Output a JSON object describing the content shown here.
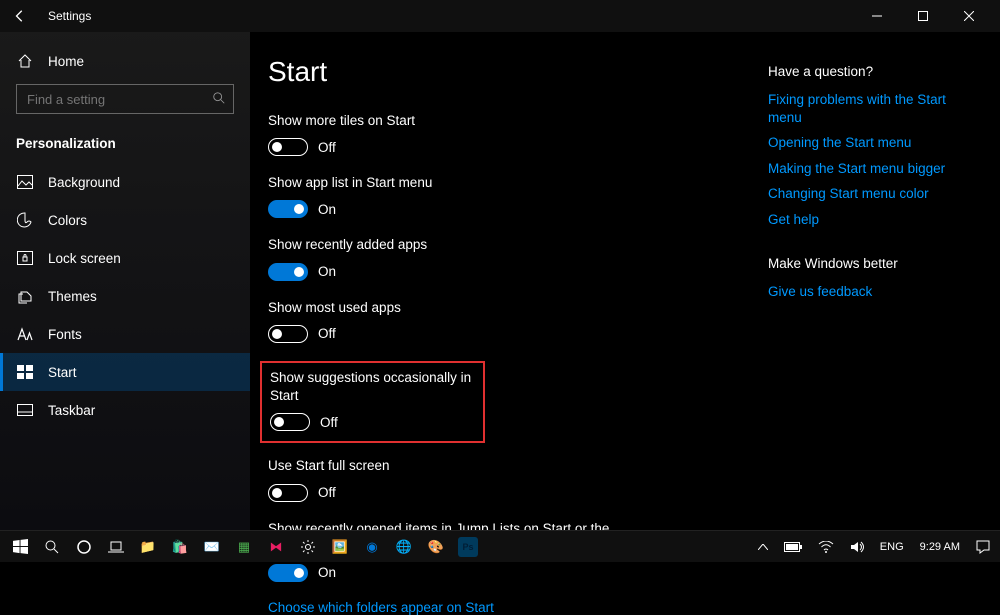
{
  "window": {
    "title": "Settings"
  },
  "sidebar": {
    "home_label": "Home",
    "search_placeholder": "Find a setting",
    "category": "Personalization",
    "items": [
      {
        "label": "Background"
      },
      {
        "label": "Colors"
      },
      {
        "label": "Lock screen"
      },
      {
        "label": "Themes"
      },
      {
        "label": "Fonts"
      },
      {
        "label": "Start"
      },
      {
        "label": "Taskbar"
      }
    ]
  },
  "page": {
    "title": "Start",
    "settings": [
      {
        "label": "Show more tiles on Start",
        "on": false,
        "state": "Off"
      },
      {
        "label": "Show app list in Start menu",
        "on": true,
        "state": "On"
      },
      {
        "label": "Show recently added apps",
        "on": true,
        "state": "On"
      },
      {
        "label": "Show most used apps",
        "on": false,
        "state": "Off"
      },
      {
        "label": "Show suggestions occasionally in Start",
        "on": false,
        "state": "Off",
        "highlighted": true
      },
      {
        "label": "Use Start full screen",
        "on": false,
        "state": "Off"
      },
      {
        "label": "Show recently opened items in Jump Lists on Start or the taskbar and in File Explorer Quick Access",
        "on": true,
        "state": "On"
      }
    ],
    "footer_link": "Choose which folders appear on Start"
  },
  "right": {
    "question_heading": "Have a question?",
    "help_links": [
      "Fixing problems with the Start menu",
      "Opening the Start menu",
      "Making the Start menu bigger",
      "Changing Start menu color",
      "Get help"
    ],
    "improve_heading": "Make Windows better",
    "feedback_link": "Give us feedback"
  },
  "taskbar": {
    "lang": "ENG",
    "time": "9:29 AM"
  }
}
